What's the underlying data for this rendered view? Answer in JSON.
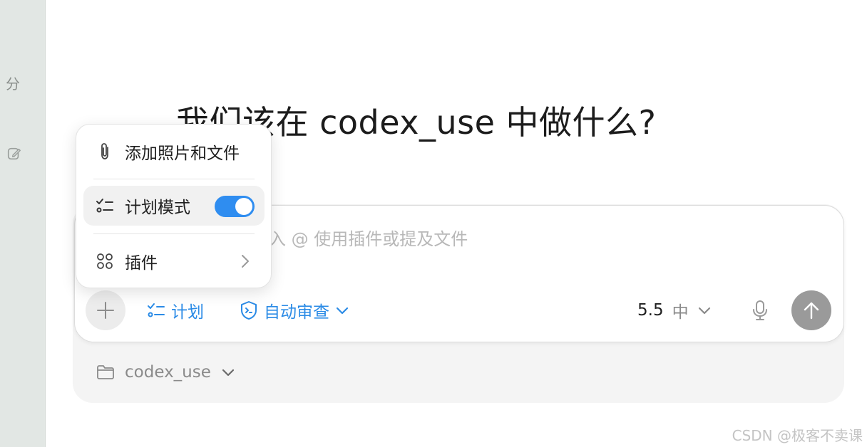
{
  "sidebar": {
    "partial_glyph": "分"
  },
  "main": {
    "heading": "我们该在 codex_use 中做什么?"
  },
  "composer": {
    "placeholder_visible": "入 @ 使用插件或提及文件",
    "toolbar": {
      "plan_label": "计划",
      "review_label": "自动审查",
      "model_version": "5.5",
      "model_effort": "中"
    }
  },
  "project": {
    "name": "codex_use"
  },
  "menu": {
    "items": [
      {
        "label": "添加照片和文件",
        "icon": "paperclip-icon"
      },
      {
        "label": "计划模式",
        "icon": "checklist-icon",
        "toggle_on": true
      },
      {
        "label": "插件",
        "icon": "grid-dots-icon"
      }
    ]
  },
  "watermark": "CSDN @极客不卖课",
  "colors": {
    "accent": "#2f8df0",
    "sidebar_bg": "#e2e7e4",
    "send_button": "#9a9a9a"
  }
}
